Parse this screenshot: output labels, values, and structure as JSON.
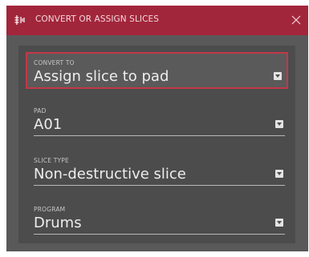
{
  "dialog": {
    "title": "CONVERT OR ASSIGN SLICES",
    "title_icon": "slice-icon",
    "close_icon": "close-icon"
  },
  "fields": [
    {
      "label": "CONVERT TO",
      "value": "Assign slice to pad",
      "selected": true
    },
    {
      "label": "PAD",
      "value": "A01",
      "selected": false
    },
    {
      "label": "SLICE TYPE",
      "value": "Non-destructive slice",
      "selected": false
    },
    {
      "label": "PROGRAM",
      "value": "Drums",
      "selected": false
    }
  ],
  "colors": {
    "titlebar": "#a2263b",
    "selection_border": "#c43749",
    "dialog_bg": "#595959",
    "panel_bg": "#4c4c4c"
  }
}
